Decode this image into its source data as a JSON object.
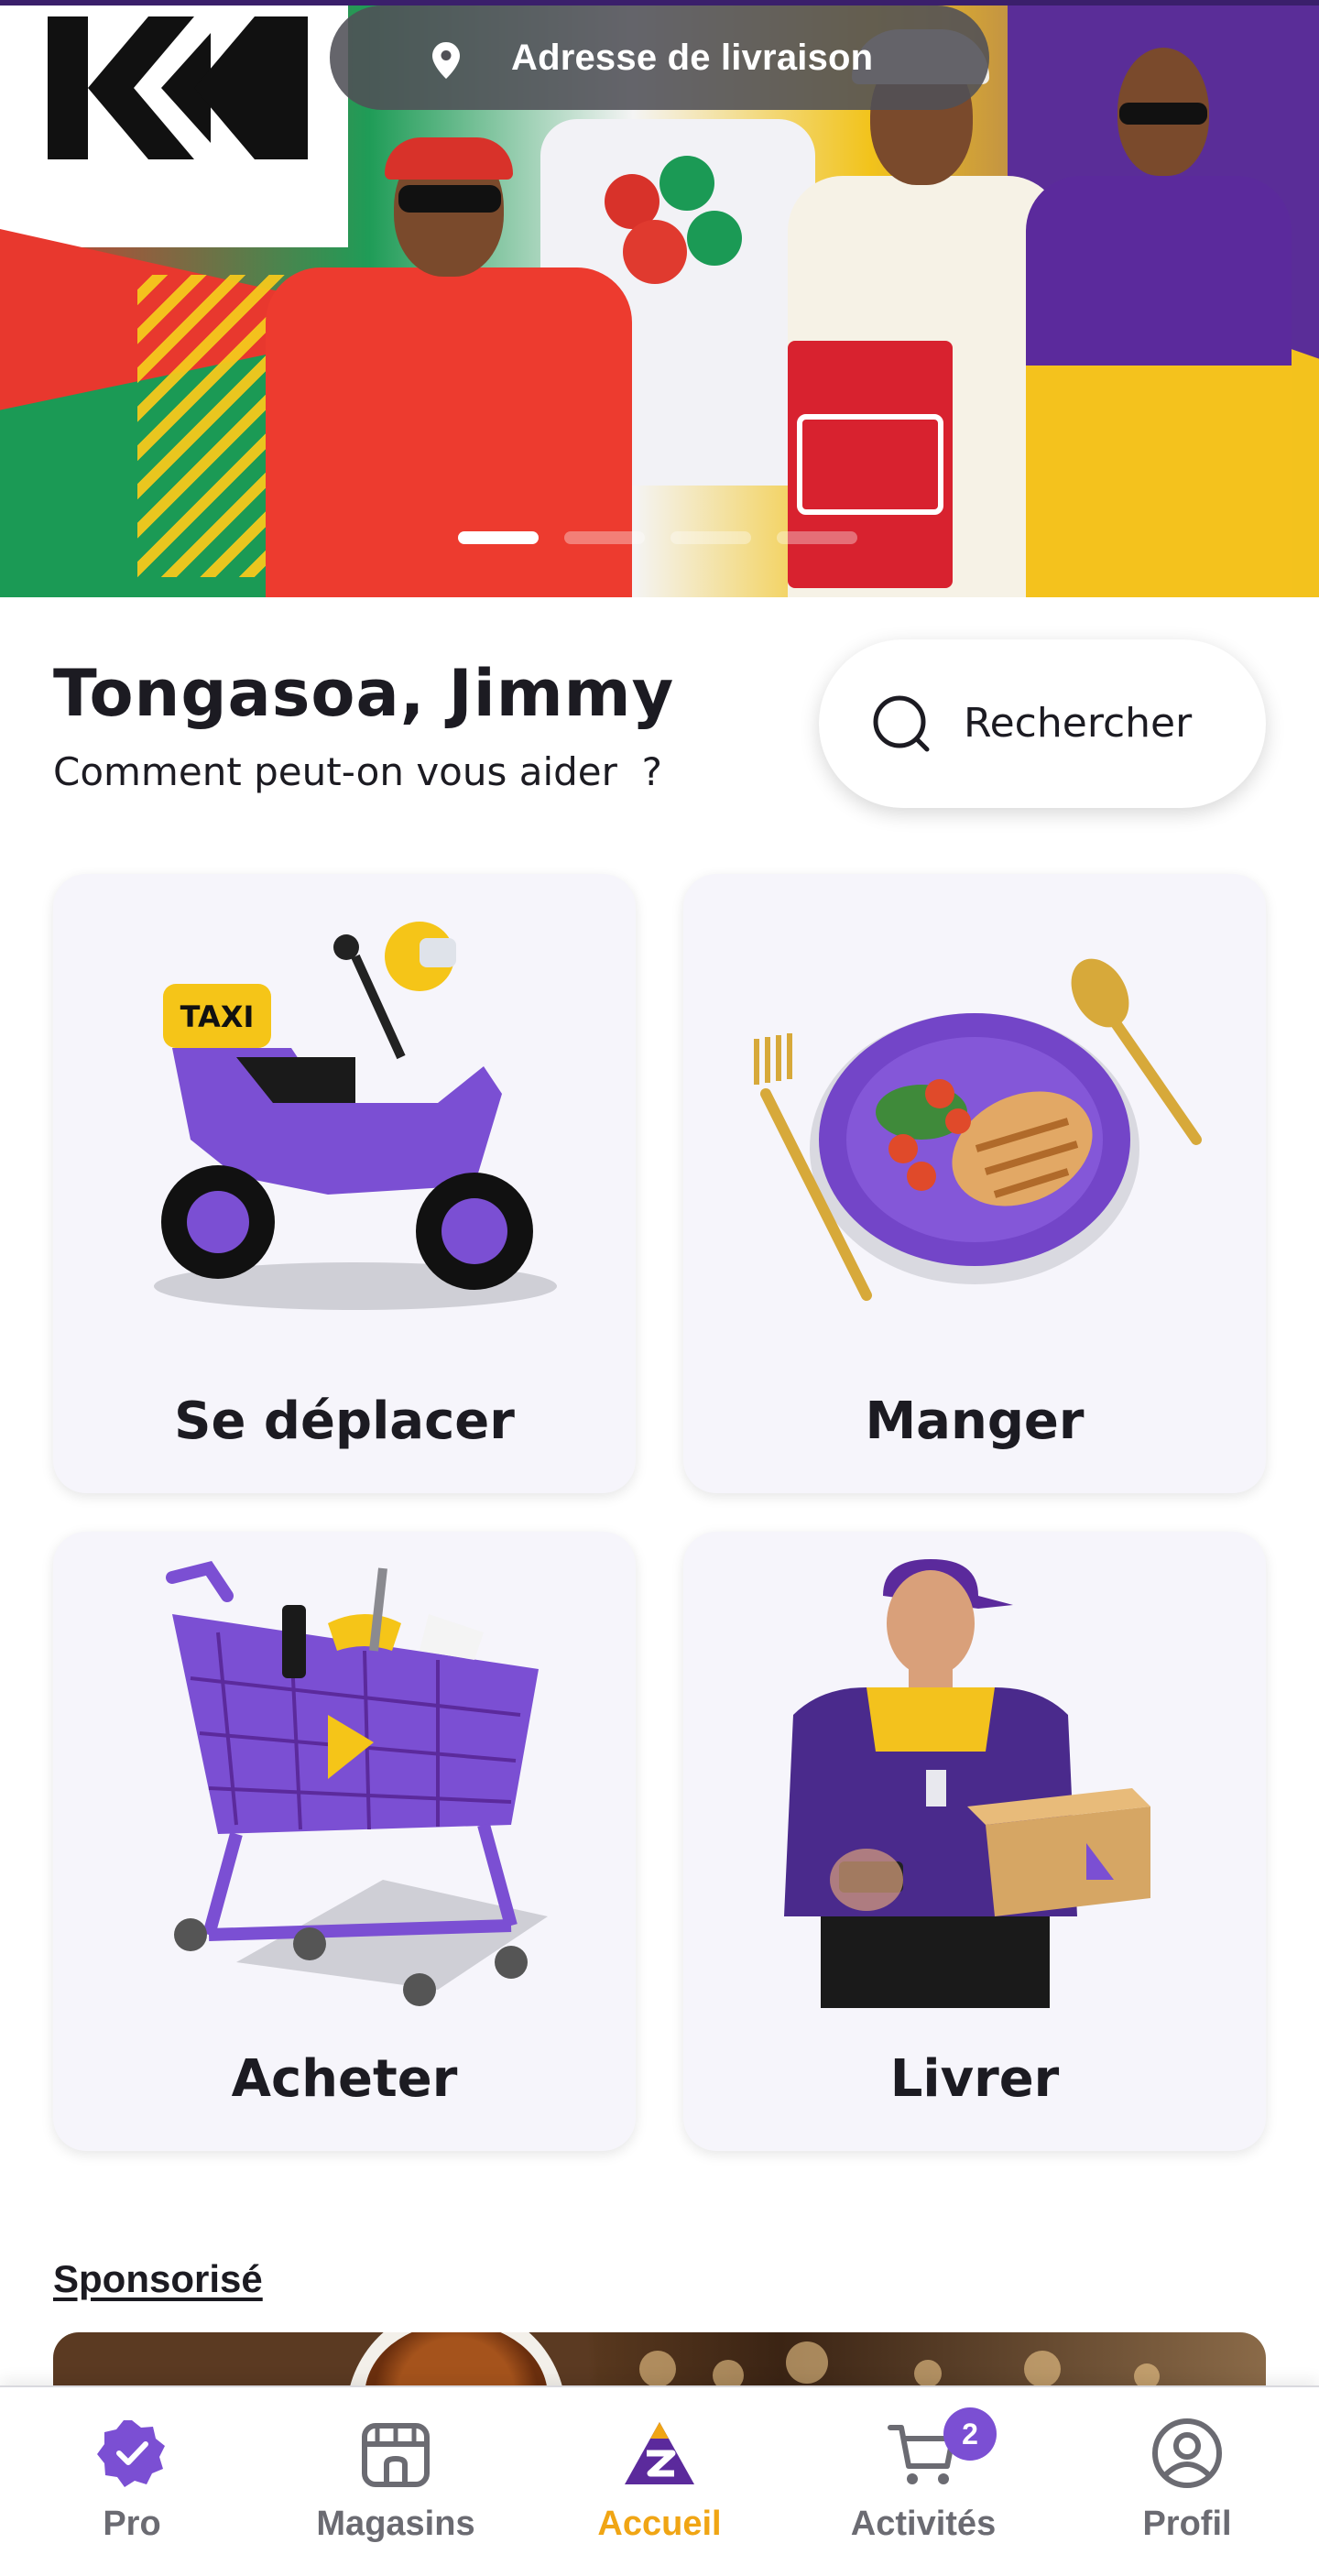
{
  "banner": {
    "address_label": "Adresse de livraison",
    "brand_logo_text": "KH",
    "carousel": {
      "count": 4,
      "active_index": 0
    }
  },
  "greeting": {
    "title": "Tongasoa, Jimmy",
    "subtitle": "Comment peut-on vous aider  ?"
  },
  "search": {
    "label": "Rechercher"
  },
  "services": [
    {
      "label": "Se déplacer",
      "icon": "taxi-scooter-icon"
    },
    {
      "label": "Manger",
      "icon": "food-plate-icon"
    },
    {
      "label": "Acheter",
      "icon": "shopping-cart-icon"
    },
    {
      "label": "Livrer",
      "icon": "delivery-person-icon"
    }
  ],
  "sponsored": {
    "label": "Sponsorisé"
  },
  "bottom_nav": [
    {
      "label": "Pro",
      "icon": "pro-badge-icon",
      "active": false
    },
    {
      "label": "Magasins",
      "icon": "store-icon",
      "active": false
    },
    {
      "label": "Accueil",
      "icon": "home-logo-icon",
      "active": true
    },
    {
      "label": "Activités",
      "icon": "cart-icon",
      "badge": "2",
      "active": false
    },
    {
      "label": "Profil",
      "icon": "profile-icon",
      "active": false
    }
  ],
  "colors": {
    "accent_purple": "#5b2a9c",
    "accent_yellow": "#f0a514",
    "badge_purple": "#7b4fd3",
    "text_dark": "#1c1b22",
    "card_bg": "#f6f5fb"
  }
}
